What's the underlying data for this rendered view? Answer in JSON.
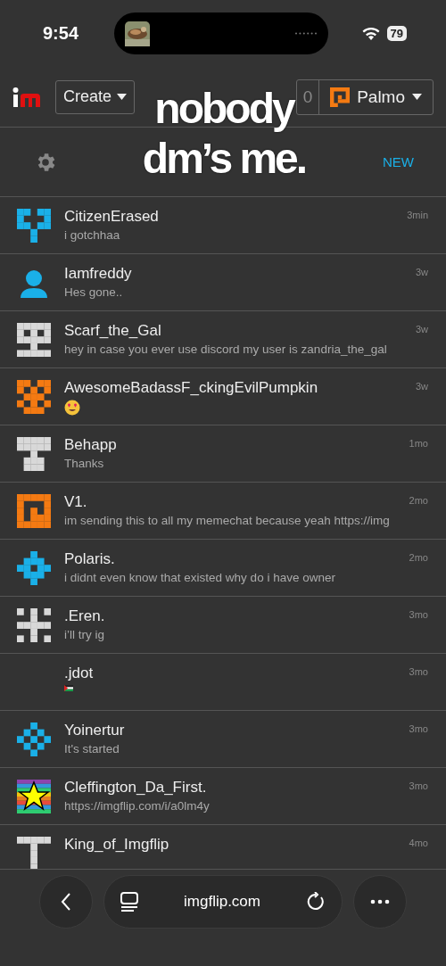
{
  "status_bar": {
    "time": "9:54",
    "battery": "79"
  },
  "header": {
    "create": "Create",
    "counter": "0",
    "user": "Palmo"
  },
  "chat_header": {
    "new": "NEW"
  },
  "caption": "nobody dm’s me.",
  "chats": [
    {
      "name": "CitizenErased",
      "message": "i gotchhaa",
      "time": "3min",
      "kind": "pixel",
      "color": "#1ab0e8"
    },
    {
      "name": "Iamfreddy",
      "message": "Hes gone..",
      "time": "3w",
      "kind": "person",
      "color": "#1ab0e8"
    },
    {
      "name": "Scarf_the_Gal",
      "message": "hey in case you ever use discord my user is zandria_the_gal",
      "time": "3w",
      "kind": "pixel",
      "color": "#d8d8d8"
    },
    {
      "name": "AwesomeBadassF_ckingEvilPumpkin",
      "time": "3w",
      "kind": "pixel",
      "color": "#f47a12",
      "emoji": {
        "kind": "heart-eyes"
      }
    },
    {
      "name": "Behapp",
      "message": "Thanks",
      "time": "1mo",
      "kind": "pixel",
      "color": "#d8d8d8"
    },
    {
      "name": "V1.",
      "message": "im sending this to all my memechat because yeah https://img",
      "time": "2mo",
      "kind": "pixel",
      "color": "#f47a12"
    },
    {
      "name": "Polaris.",
      "message": "i didnt even know that existed why do i have owner",
      "time": "2mo",
      "kind": "pixel",
      "color": "#1ab0e8"
    },
    {
      "name": ".Eren.",
      "message": "i’ll try ig",
      "time": "3mo",
      "kind": "pixel",
      "color": "#d8d8d8"
    },
    {
      "name": ".jdot",
      "time": "3mo",
      "kind": "blank",
      "emoji": {
        "kind": "flag"
      }
    },
    {
      "name": "Yoinertur",
      "message": "It's started",
      "time": "3mo",
      "kind": "pixel",
      "color": "#1ab0e8"
    },
    {
      "name": "Cleffington_Da_First.",
      "message": "https://imgflip.com/i/a0lm4y",
      "time": "3mo",
      "kind": "rainbow"
    },
    {
      "name": "King_of_Imgflip",
      "time": "4mo",
      "kind": "pixel",
      "color": "#d8d8d8"
    }
  ],
  "browser_bar": {
    "url": "imgflip.com"
  }
}
